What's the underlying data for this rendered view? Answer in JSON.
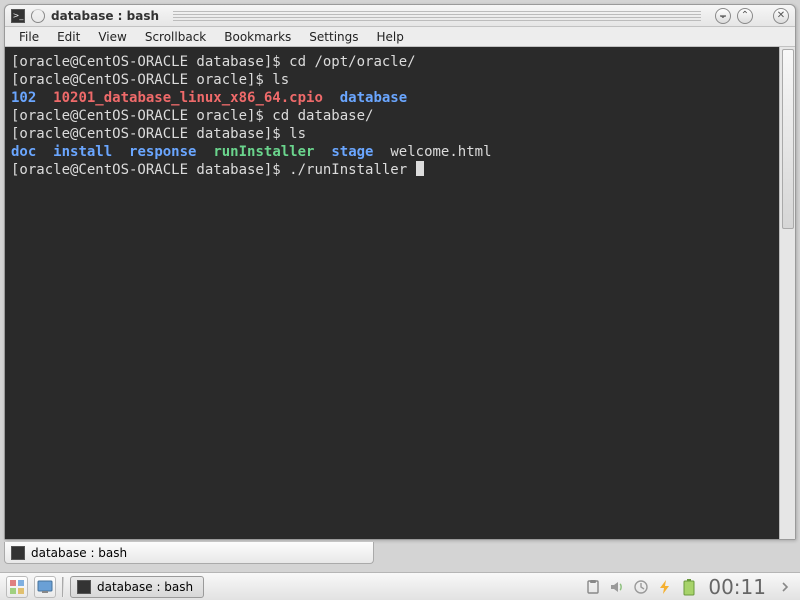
{
  "window": {
    "title": "database : bash"
  },
  "menu": {
    "file": "File",
    "edit": "Edit",
    "view": "View",
    "scrollback": "Scrollback",
    "bookmarks": "Bookmarks",
    "settings": "Settings",
    "help": "Help"
  },
  "terminal": {
    "l1_prompt": "[oracle@CentOS-ORACLE database]$ ",
    "l1_cmd": "cd /opt/oracle/",
    "l2_prompt": "[oracle@CentOS-ORACLE oracle]$ ",
    "l2_cmd": "ls",
    "l3_a": "102",
    "l3_b": "10201_database_linux_x86_64.cpio",
    "l3_c": "database",
    "l4_prompt": "[oracle@CentOS-ORACLE oracle]$ ",
    "l4_cmd": "cd database/",
    "l5_prompt": "[oracle@CentOS-ORACLE database]$ ",
    "l5_cmd": "ls",
    "l6_a": "doc",
    "l6_b": "install",
    "l6_c": "response",
    "l6_d": "runInstaller",
    "l6_e": "stage",
    "l6_f": "welcome.html",
    "l7_prompt": "[oracle@CentOS-ORACLE database]$ ",
    "l7_cmd": "./runInstaller "
  },
  "tab": {
    "label": "database : bash"
  },
  "task": {
    "label": "database : bash"
  },
  "clock": "00:11"
}
